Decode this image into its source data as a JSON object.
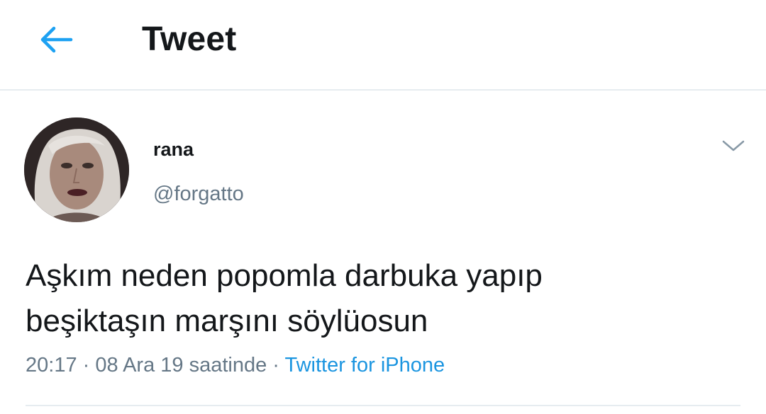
{
  "header": {
    "title": "Tweet",
    "back_icon": "arrow-left-icon",
    "accent_color": "#1da1f2"
  },
  "tweet": {
    "author": {
      "display_name": "rana",
      "username": "@forgatto",
      "avatar_icon": "avatar-photo"
    },
    "text_lines": [
      "Aşkım neden popomla darbuka yapıp",
      "beşiktaşın marşını söylüosun"
    ],
    "meta": {
      "time": "20:17",
      "separator": " · ",
      "date": "08 Ara 19 saatinde",
      "source": "Twitter for iPhone",
      "source_color": "#1b95e0"
    },
    "more_icon": "chevron-down-icon"
  }
}
